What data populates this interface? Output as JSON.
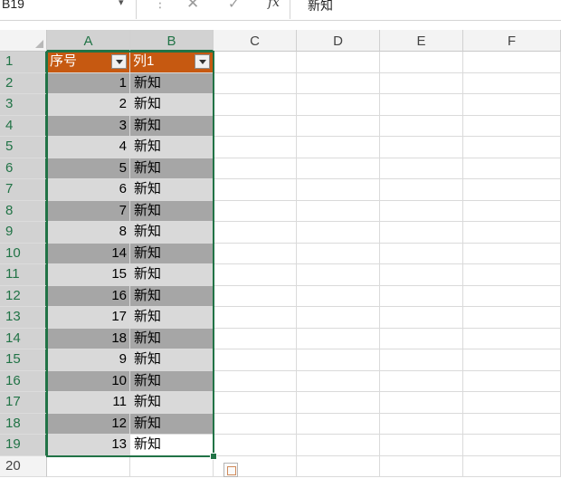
{
  "formula_bar": {
    "name_box": "B19",
    "dropdown_glyph": "▾",
    "separator_glyph": "⋮",
    "cancel_glyph": "✕",
    "enter_glyph": "✓",
    "fx_label": "fx",
    "value": "新知"
  },
  "columns": [
    "A",
    "B",
    "C",
    "D",
    "E",
    "F"
  ],
  "row_numbers": [
    "1",
    "2",
    "3",
    "4",
    "5",
    "6",
    "7",
    "8",
    "9",
    "10",
    "11",
    "12",
    "13",
    "14",
    "15",
    "16",
    "17",
    "18",
    "19",
    "20"
  ],
  "table": {
    "headers": [
      "序号",
      "列1"
    ],
    "rows": [
      [
        "1",
        "新知"
      ],
      [
        "2",
        "新知"
      ],
      [
        "3",
        "新知"
      ],
      [
        "4",
        "新知"
      ],
      [
        "5",
        "新知"
      ],
      [
        "6",
        "新知"
      ],
      [
        "7",
        "新知"
      ],
      [
        "8",
        "新知"
      ],
      [
        "14",
        "新知"
      ],
      [
        "15",
        "新知"
      ],
      [
        "16",
        "新知"
      ],
      [
        "17",
        "新知"
      ],
      [
        "18",
        "新知"
      ],
      [
        "9",
        "新知"
      ],
      [
        "10",
        "新知"
      ],
      [
        "11",
        "新知"
      ],
      [
        "12",
        "新知"
      ],
      [
        "13",
        "新知"
      ]
    ],
    "header_color": "#c65911",
    "band_dark_color": "#a6a6a6",
    "band_light_color": "#d9d9d9"
  },
  "selection": {
    "range": "A1:B19",
    "active_cell": "B19",
    "accent_color": "#217346"
  },
  "icons": {
    "quick_analysis": "quick-analysis-icon",
    "filter_dropdown": "filter-dropdown-icon"
  }
}
